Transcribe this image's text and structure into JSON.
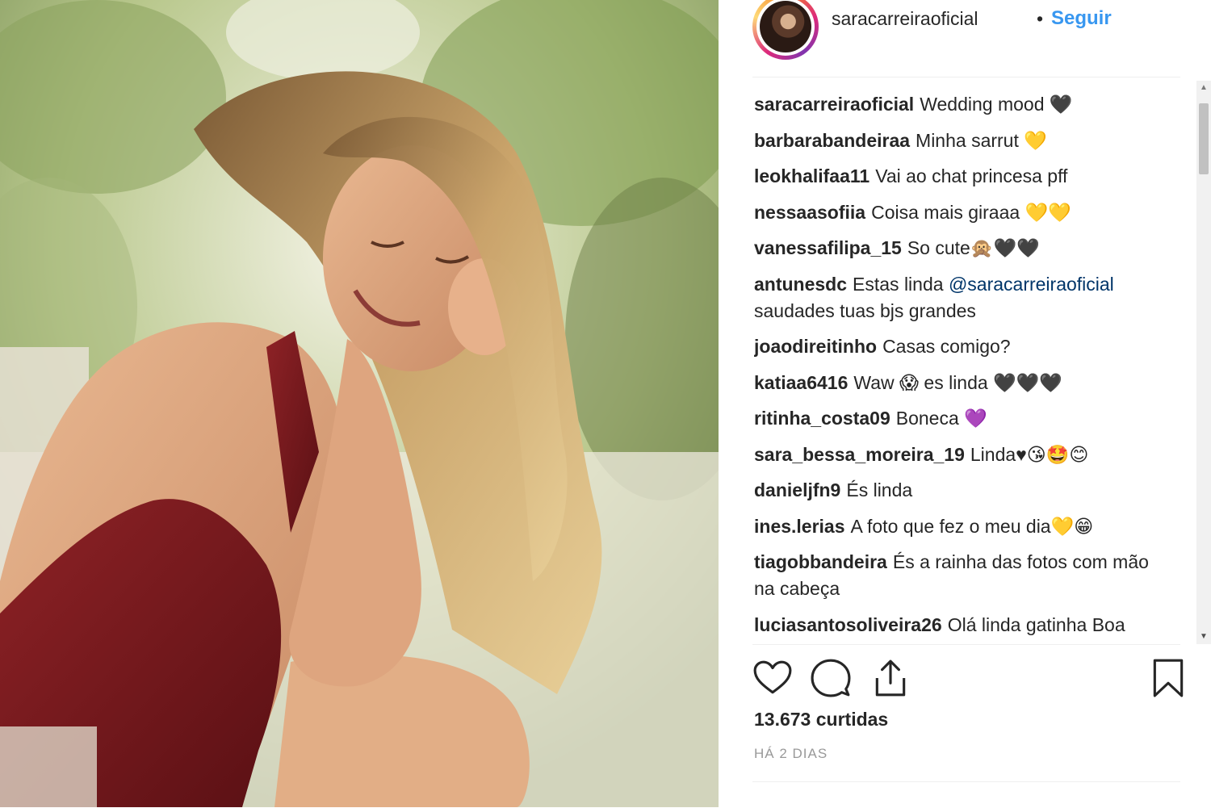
{
  "post": {
    "username": "saracarreiraoficial",
    "separator": "•",
    "follow_label": "Seguir",
    "likes": "13.673 curtidas",
    "timestamp": "HÁ 2 DIAS"
  },
  "comments": [
    {
      "user": "saracarreiraoficial",
      "text": "Wedding mood 🖤"
    },
    {
      "user": "barbarabandeiraa",
      "text": "Minha sarrut 💛"
    },
    {
      "user": "leokhalifaa11",
      "text": "Vai ao chat princesa pff"
    },
    {
      "user": "nessaasofiia",
      "text": "Coisa mais giraaa 💛💛"
    },
    {
      "user": "vanessafilipa_15",
      "text": "So cute🙊🖤🖤"
    },
    {
      "user": "antunesdc",
      "text": "Estas linda ",
      "mention": "@saracarreiraoficial",
      "text_after": " saudades tuas bjs grandes"
    },
    {
      "user": "joaodireitinho",
      "text": "Casas comigo?"
    },
    {
      "user": "katiaa6416",
      "text": "Waw 😱 es linda 🖤🖤🖤"
    },
    {
      "user": "ritinha_costa09",
      "text": "Boneca 💜"
    },
    {
      "user": "sara_bessa_moreira_19",
      "text": "Linda♥😘🤩😊"
    },
    {
      "user": "danieljfn9",
      "text": "És linda"
    },
    {
      "user": "ines.lerias",
      "text": "A foto que fez o meu dia💛😁"
    },
    {
      "user": "tiagobbandeira",
      "text": "És a rainha das fotos com mão na cabeça"
    },
    {
      "user": "luciasantosoliveira26",
      "text": "Olá linda gatinha Boa"
    }
  ],
  "icons": {
    "like": "heart-icon",
    "comment": "speech-bubble-icon",
    "share": "share-icon",
    "save": "bookmark-icon"
  },
  "colors": {
    "follow": "#3897f0",
    "text": "#262626",
    "muted": "#999999",
    "mention": "#003569",
    "dress": "#7a1a1e"
  }
}
